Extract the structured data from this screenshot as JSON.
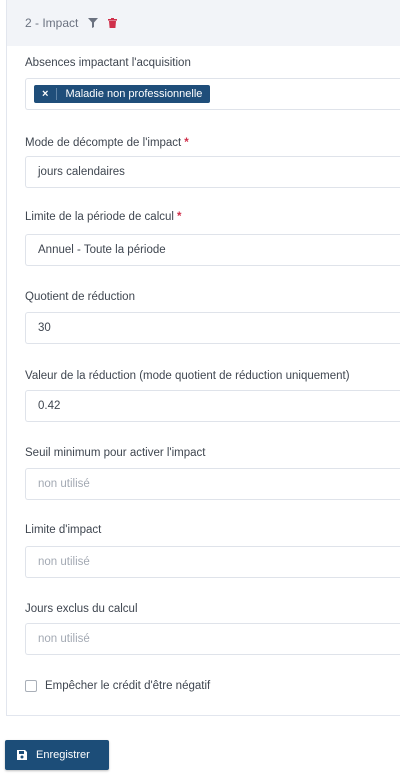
{
  "panel": {
    "title": "2 - Impact",
    "icons": [
      "filter-icon",
      "trash-icon"
    ]
  },
  "fields": {
    "absences": {
      "label": "Absences impactant l'acquisition",
      "tag": "Maladie non professionnelle",
      "tag_remove": "×"
    },
    "mode": {
      "label": "Mode de décompte de l'impact",
      "required_mark": "*",
      "value": "jours calendaires"
    },
    "limite_periode": {
      "label": "Limite de la période de calcul",
      "required_mark": "*",
      "value": "Annuel - Toute la période"
    },
    "quotient": {
      "label": "Quotient de réduction",
      "value": "30"
    },
    "valeur_reduction": {
      "label": "Valeur de la réduction (mode quotient de réduction uniquement)",
      "value": "0.42"
    },
    "seuil": {
      "label": "Seuil minimum pour activer l'impact",
      "placeholder": "non utilisé"
    },
    "limite_impact": {
      "label": "Limite d'impact",
      "placeholder": "non utilisé"
    },
    "jours_exclus": {
      "label": "Jours exclus du calcul",
      "placeholder": "non utilisé"
    }
  },
  "checkbox": {
    "label": "Empêcher le crédit d'être négatif",
    "checked": false
  },
  "save": {
    "label": "Enregistrer",
    "icon": "save-icon"
  },
  "colors": {
    "primary": "#1c4d78",
    "tag": "#1f4e7a",
    "header_bg": "#f2f4f8",
    "required": "#d0304b",
    "trash": "#d0304b"
  }
}
